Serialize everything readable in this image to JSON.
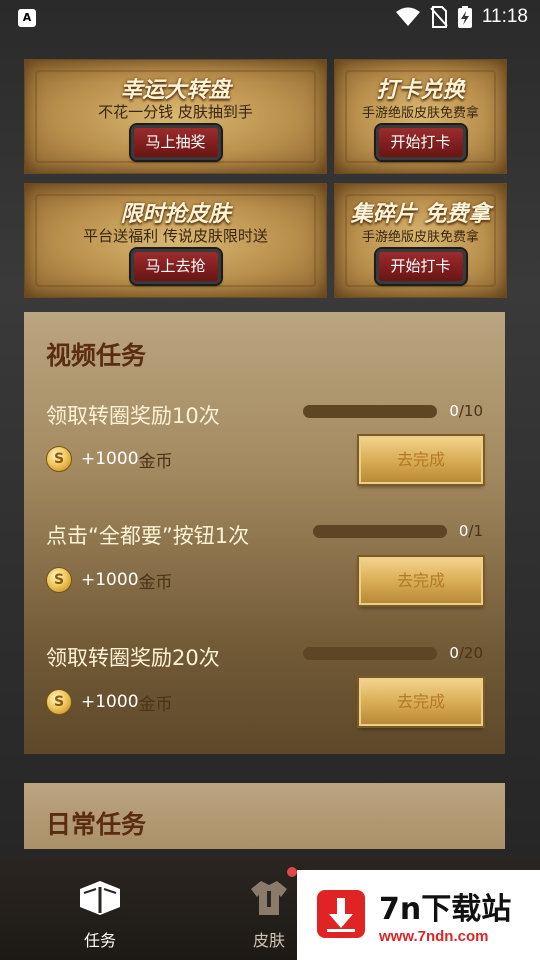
{
  "status_bar": {
    "left_icon_text": "A",
    "time": "11:18"
  },
  "banners": [
    {
      "title": "幸运大转盘",
      "subtitle": "不花一分钱 皮肤抽到手",
      "button": "马上抽奖"
    },
    {
      "title": "打卡兑换",
      "subtitle": "手游绝版皮肤免费拿",
      "button": "开始打卡"
    },
    {
      "title": "限时抢皮肤",
      "subtitle": "平台送福利 传说皮肤限时送",
      "button": "马上去抢"
    },
    {
      "title": "集碎片 免费拿",
      "subtitle": "手游绝版皮肤免费拿",
      "button": "开始打卡"
    }
  ],
  "video_tasks": {
    "title": "视频任务",
    "items": [
      {
        "name": "领取转圈奖励10次",
        "progress_current": "0",
        "progress_total": "/10",
        "progress_fraction": 0,
        "reward_amount": "+1000",
        "reward_unit": "金币",
        "button": "去完成"
      },
      {
        "name": "点击“全都要”按钮1次",
        "progress_current": "0",
        "progress_total": "/1",
        "progress_fraction": 0,
        "reward_amount": "+1000",
        "reward_unit": "金币",
        "button": "去完成"
      },
      {
        "name": "领取转圈奖励20次",
        "progress_current": "0",
        "progress_total": "/20",
        "progress_fraction": 0,
        "reward_amount": "+1000",
        "reward_unit": "金币",
        "button": "去完成"
      }
    ]
  },
  "daily_tasks": {
    "title": "日常任务"
  },
  "bottom_nav": {
    "items": [
      {
        "label": "任务",
        "icon": "book-icon",
        "active": true
      },
      {
        "label": "皮肤",
        "icon": "shirt-icon",
        "active": false,
        "badge": true
      }
    ]
  },
  "watermark": {
    "title": "7n下载站",
    "url": "www.7ndn.com"
  },
  "colors": {
    "panel_title": "#5a2d10",
    "button_red": "#8a2020",
    "button_gold": "#d9ae55",
    "nav_active": "#ffffff",
    "badge": "#e04848",
    "watermark_red": "#e02424"
  }
}
